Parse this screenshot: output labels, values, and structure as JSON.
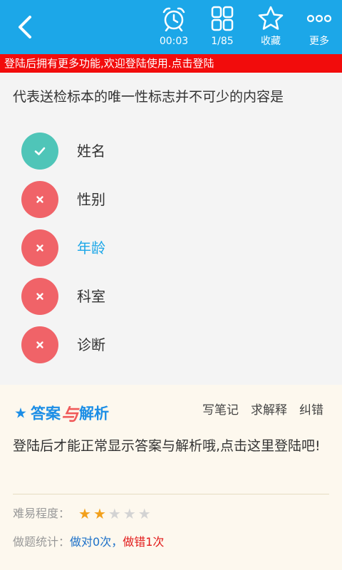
{
  "toolbar": {
    "timer_label": "00:03",
    "progress_label": "1/85",
    "favorite_label": "收藏",
    "more_label": "更多"
  },
  "banner": {
    "text": "登陆后拥有更多功能,欢迎登陆使用.点击登陆"
  },
  "question": {
    "text": "代表送检标本的唯一性标志并不可少的内容是",
    "options": [
      {
        "label": "姓名",
        "state": "correct"
      },
      {
        "label": "性别",
        "state": "wrong"
      },
      {
        "label": "年龄",
        "state": "wrong",
        "selected": true
      },
      {
        "label": "科室",
        "state": "wrong"
      },
      {
        "label": "诊断",
        "state": "wrong"
      }
    ]
  },
  "answer": {
    "title_star": "★",
    "title_part1": "答案",
    "title_part2": "与",
    "title_part3": "解析",
    "write_note": "写笔记",
    "ask_explain": "求解释",
    "report_error": "纠错",
    "message": "登陆后才能正常显示答案与解析哦,点击这里登陆吧!",
    "difficulty_label": "难易程度：",
    "difficulty_rating": 2,
    "difficulty_max": 5,
    "stats_label": "做题统计：",
    "stats_right": "做对0次，",
    "stats_wrong": "做错1次"
  },
  "colors": {
    "brand": "#1ca7e8",
    "banner": "#f20c0c",
    "correct": "#4fc5b8",
    "wrong": "#f06368",
    "star_on": "#f2a01c"
  }
}
